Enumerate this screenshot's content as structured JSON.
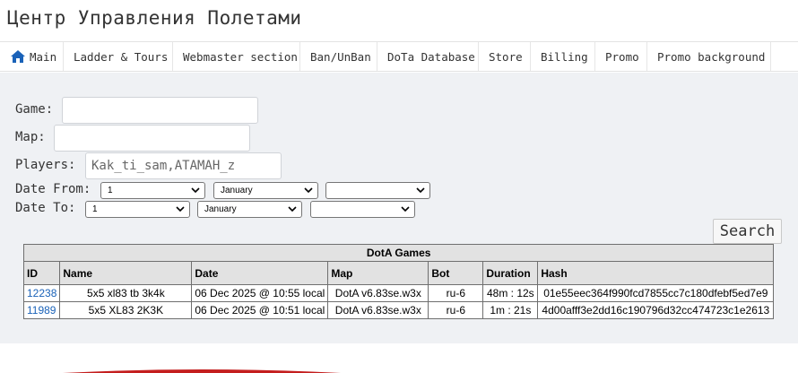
{
  "site_title": "Центр Управления Полетами",
  "nav": {
    "items": [
      {
        "label": "Main",
        "icon": "home-icon"
      },
      {
        "label": "Ladder & Tours"
      },
      {
        "label": "Webmaster section"
      },
      {
        "label": "Ban/UnBan"
      },
      {
        "label": "DoTa Database"
      },
      {
        "label": "Store"
      },
      {
        "label": "Billing"
      },
      {
        "label": "Promo"
      },
      {
        "label": "Promo background"
      }
    ]
  },
  "form": {
    "game_label": "Game:",
    "game_value": "",
    "map_label": "Map:",
    "map_value": "",
    "players_label": "Players:",
    "players_value": "Kak_ti_sam,ATAMAH_z",
    "date_from_label": "Date From:",
    "date_from": {
      "day": "1",
      "month": "January",
      "year": ""
    },
    "date_to_label": "Date To:",
    "date_to": {
      "day": "1",
      "month": "January",
      "year": ""
    },
    "search_label": "Search"
  },
  "games_table": {
    "caption": "DotA Games",
    "columns": [
      "ID",
      "Name",
      "Date",
      "Map",
      "Bot",
      "Duration",
      "Hash"
    ],
    "rows": [
      {
        "id": "12238",
        "name": "5x5 xl83 tb 3k4k",
        "date": "06 Dec 2025 @ 10:55 local",
        "map": "DotA v6.83se.w3x",
        "bot": "ru-6",
        "duration": "48m : 12s",
        "hash": "01e55eec364f990fcd7855cc7c180dfebf5ed7e9"
      },
      {
        "id": "11989",
        "name": "5x5 XL83 2K3K",
        "date": "06 Dec 2025 @ 10:51 local",
        "map": "DotA v6.83se.w3x",
        "bot": "ru-6",
        "duration": "1m : 21s",
        "hash": "4d00afff3e2dd16c190796d32cc474723c1e2613"
      }
    ]
  },
  "colors": {
    "content_bg": "#eff1f4",
    "link": "#1a62b8",
    "home_icon": "#1a62b8"
  }
}
